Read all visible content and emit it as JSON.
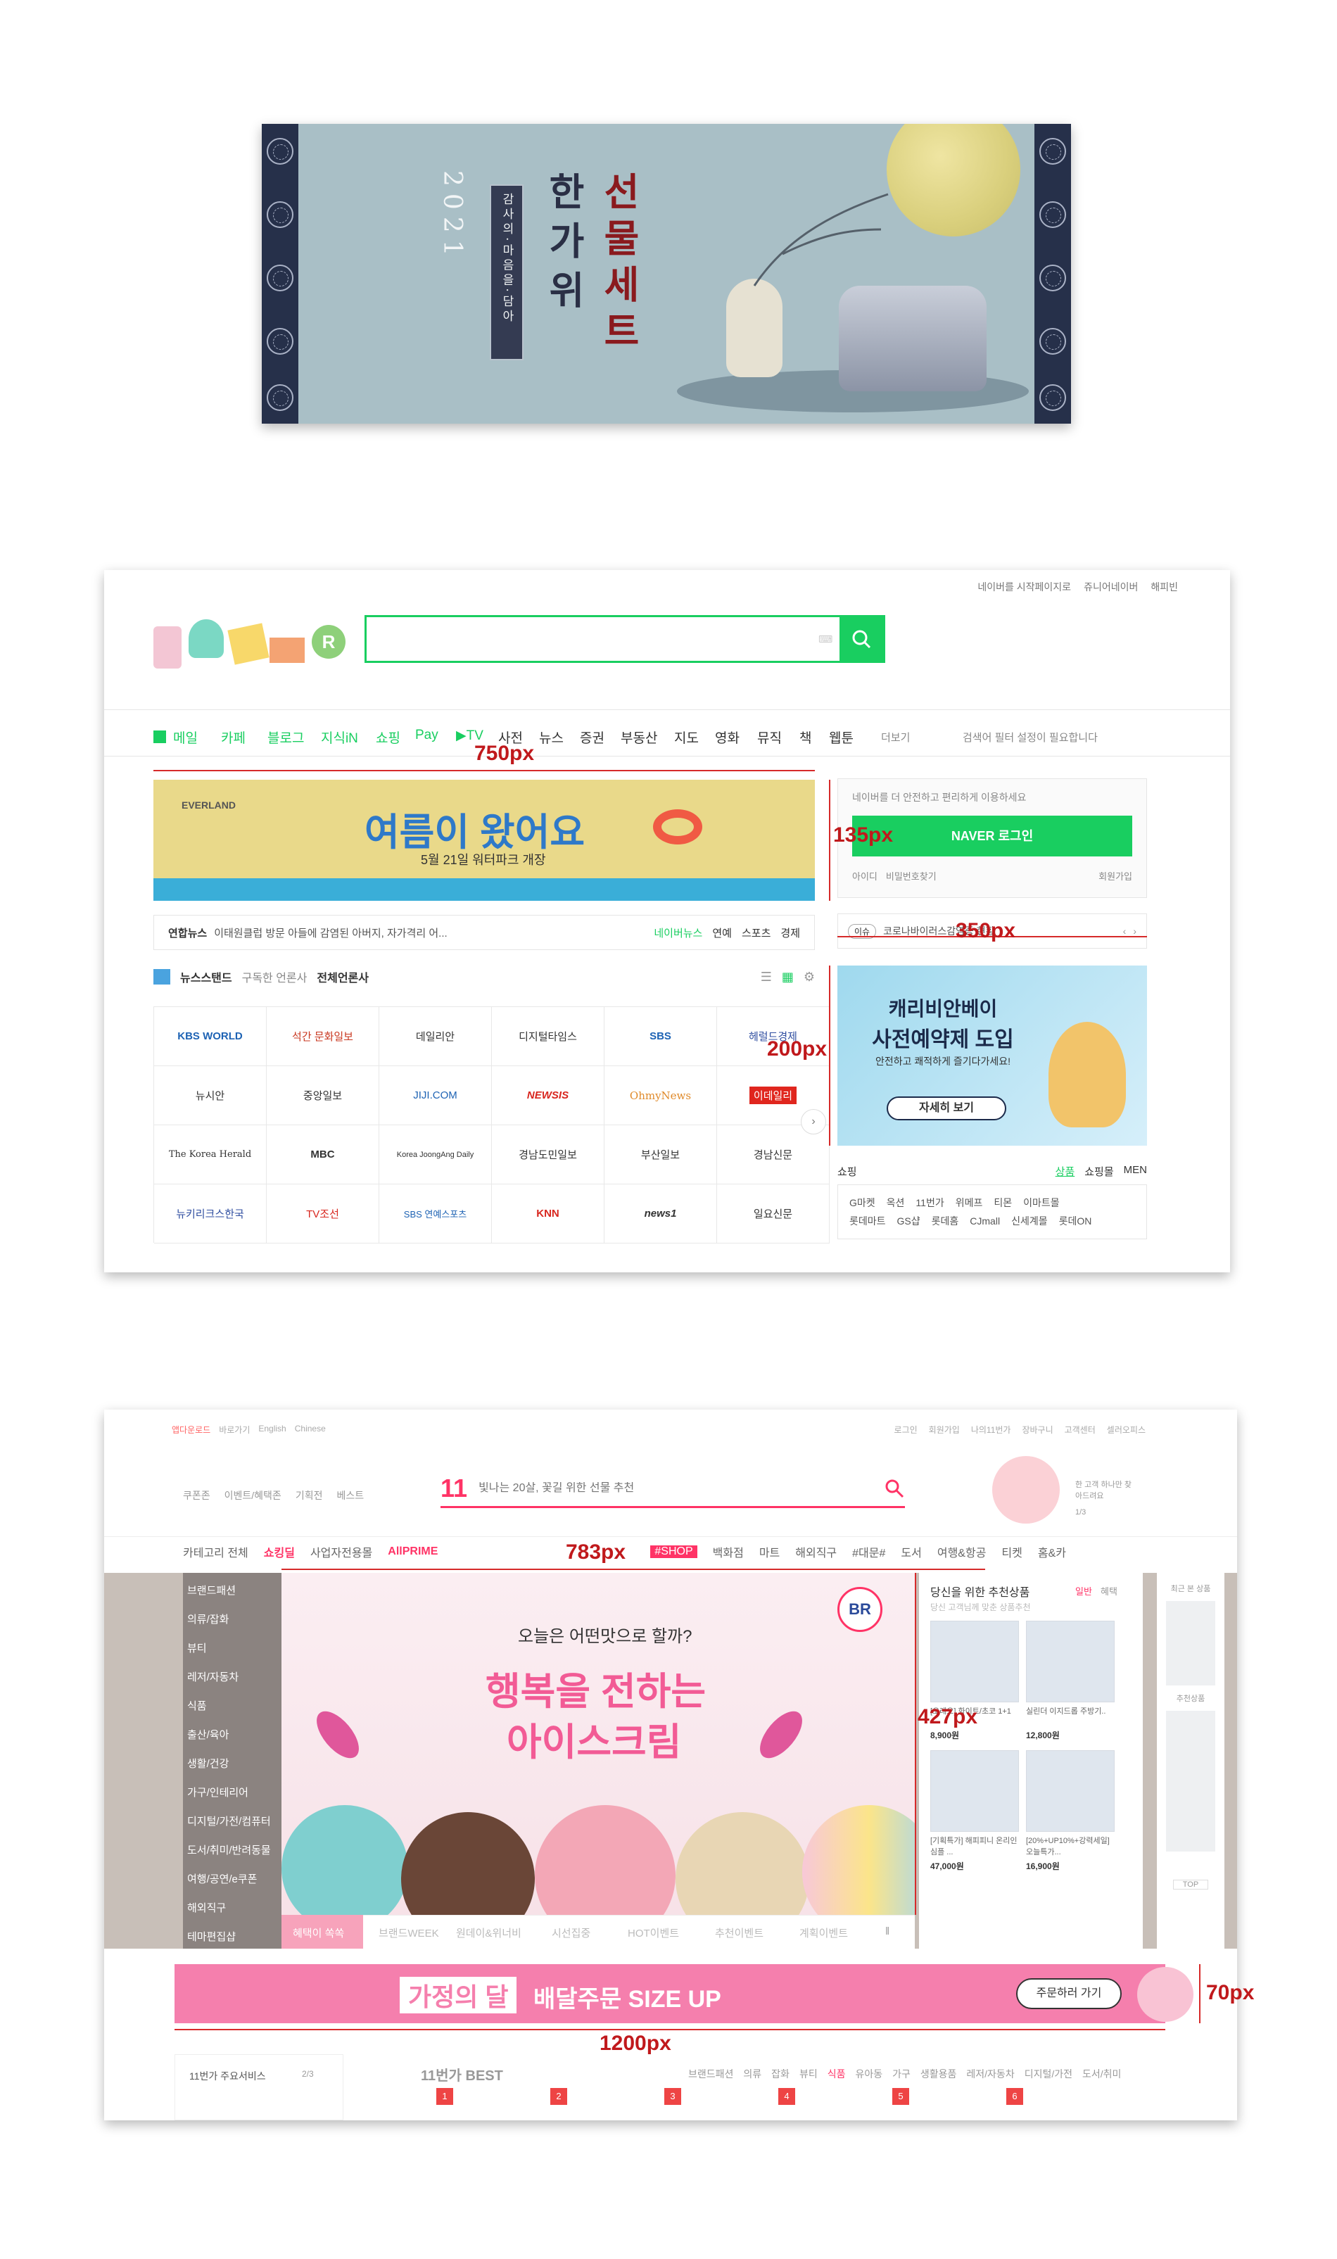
{
  "panel1": {
    "year": "2021",
    "tagline": "감사의·마음을·담아",
    "title_left": "한가위",
    "title_right": "선물세트",
    "colors": {
      "bg": "#a9bfc6",
      "side": "#26304a",
      "title_dark": "#2a2f45",
      "title_red": "#8a1a1e"
    }
  },
  "panel2": {
    "top_links": [
      "네이버를 시작페이지로",
      "쥬니어네이버",
      "해피빈"
    ],
    "search_placeholder": "",
    "nav": [
      "메일",
      "카페",
      "블로그",
      "지식iN",
      "쇼핑",
      "Pay",
      "▶TV",
      "사전",
      "뉴스",
      "증권",
      "부동산",
      "지도",
      "영화",
      "뮤직",
      "책",
      "웹툰"
    ],
    "more": "더보기",
    "notice": "검색어 필터 설정이 필요합니다",
    "banner": {
      "brand": "EVERLAND",
      "headline": "여름이 왔어요",
      "sub": "5월 21일 워터파크 개장"
    },
    "news_ticker": {
      "source": "연합뉴스",
      "text": "이태원클럽 방문 아들에 감염된 아버지, 자가격리 어...",
      "links": [
        "네이버뉴스",
        "연예",
        "스포츠",
        "경제"
      ]
    },
    "newsstand": {
      "title": "뉴스스탠드",
      "subscribed": "구독한 언론사",
      "all": "전체언론사"
    },
    "press": [
      "KBS WORLD",
      "석간 문화일보",
      "데일리안",
      "디지털타임스",
      "SBS",
      "헤럴드경제",
      "뉴시안",
      "중앙일보",
      "JIJI.COM",
      "NEWSIS",
      "OhmyNews",
      "이데일리",
      "The Korea Herald",
      "MBC",
      "Korea JoongAng Daily",
      "경남도민일보",
      "부산일보",
      "경남신문",
      "뉴키리크스한국",
      "TV조선",
      "SBS 연예스포츠",
      "KNN",
      "news1",
      "일요신문"
    ],
    "login_box": {
      "text": "네이버를 더 안전하고 편리하게 이용하세요",
      "button": "NAVER 로그인",
      "find_id": "아이디",
      "find_pw": "비밀번호찾기",
      "join": "회원가입"
    },
    "issue": {
      "badge": "이슈",
      "text": "코로나바이러스감염증 현황"
    },
    "ad": {
      "line1": "캐리비안베이",
      "line2": "사전예약제 도입",
      "line3": "안전하고 쾌적하게 즐기다가세요!",
      "button": "자세히 보기"
    },
    "shopping": {
      "title": "쇼핑",
      "tabs": [
        "상품",
        "쇼핑몰",
        "MEN"
      ],
      "row1": [
        "G마켓",
        "옥션",
        "11번가",
        "위메프",
        "티몬",
        "이마트몰"
      ],
      "row2": [
        "롯데마트",
        "GS샵",
        "롯데홈",
        "CJmall",
        "신세계몰",
        "롯데ON"
      ]
    },
    "dims": {
      "w750": "750px",
      "h135": "135px",
      "w350": "350px",
      "h200": "200px"
    }
  },
  "panel3": {
    "top_left": [
      "앱다운로드",
      "바로가기",
      "English",
      "Chinese"
    ],
    "top_right": [
      "로그인",
      "회원가입",
      "나의11번가",
      "장바구니",
      "고객센터",
      "셀러오피스"
    ],
    "subnav": [
      "쿠폰존",
      "이벤트/혜택존",
      "기획전",
      "베스트"
    ],
    "search": {
      "logo": "11",
      "placeholder": "빛나는 20살, 꽃길 위한 선물 추천"
    },
    "promo": {
      "text": "한 고객 하나만 찾아드려요",
      "pager": "1/3"
    },
    "gnb": [
      "카테고리 전체",
      "쇼킹딜",
      "사업자전용몰",
      "AllPRIME",
      "#SHOP",
      "백화점",
      "마트",
      "해외직구",
      "#대문#",
      "도서",
      "여행&항공",
      "티켓",
      "홈&카"
    ],
    "categories": [
      "브랜드패션",
      "의류/잡화",
      "뷰티",
      "레저/자동차",
      "식품",
      "출산/육아",
      "생활/건강",
      "가구/인테리어",
      "디지털/가전/컴퓨터",
      "도서/취미/반려동물",
      "여행/공연/e쿠폰",
      "해외직구",
      "테마편집샵"
    ],
    "hero": {
      "sub": "오늘은 어떤맛으로 할까?",
      "line1": "행복을 전하는",
      "line2": "아이스크림",
      "badge": "BR"
    },
    "hero_tabs": [
      "혜택이 쏙쏙",
      "브랜드WEEK",
      "원데이&위너비",
      "시선집중",
      "HOT이벤트",
      "추천이벤트",
      "계획이벤트"
    ],
    "reco": {
      "title": "당신을 위한 추천상품",
      "sub": "당신 고객님께 맞춘 상품추천",
      "tabs": [
        "일반",
        "혜택"
      ],
      "items": [
        {
          "name": "[오레오] 화이트/초코 1+1",
          "price": "8,900원"
        },
        {
          "name": "실린더 이지드롭 주방기..",
          "price": "12,800원"
        },
        {
          "name": "[기획특가] 해피피니 온리인심플 ...",
          "price": "47,000원"
        },
        {
          "name": "[20%+UP10%+강력세일] 오늘특가...",
          "price": "16,900원"
        }
      ]
    },
    "side": {
      "label": "최근 본 상품",
      "label2": "추천상품",
      "top": "TOP"
    },
    "delivery": {
      "badge": "가정의 달",
      "text": "배달주문 SIZE UP",
      "button": "주문하러 가기"
    },
    "services": {
      "title": "11번가 주요서비스",
      "pager": "2/3"
    },
    "best": {
      "title": "11번가 BEST",
      "tabs": [
        "브랜드패션",
        "의류",
        "잡화",
        "뷰티",
        "식품",
        "유아동",
        "가구",
        "생활용품",
        "레저/자동차",
        "디지털/가전",
        "도서/취미"
      ],
      "nums": [
        "1",
        "2",
        "3",
        "4",
        "5",
        "6"
      ]
    },
    "dims": {
      "w783": "783px",
      "h427": "427px",
      "h70": "70px",
      "w1200": "1200px"
    }
  }
}
